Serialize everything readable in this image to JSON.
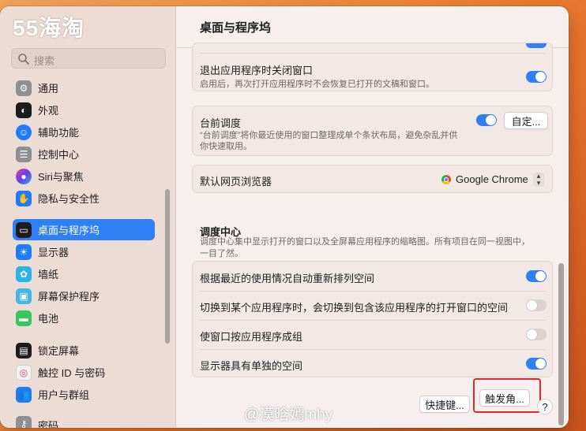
{
  "watermark": {
    "logo": "55海淘",
    "bottom_text": "@漠晗嫣mhy"
  },
  "sidebar": {
    "search_placeholder": "搜索",
    "items": [
      {
        "label": "通用",
        "icon": "gear-icon",
        "color": "#8e8e93",
        "selected": false
      },
      {
        "label": "外观",
        "icon": "appearance-icon",
        "color": "#1c1c1e",
        "selected": false
      },
      {
        "label": "辅助功能",
        "icon": "accessibility-icon",
        "color": "#1f7cf5",
        "selected": false
      },
      {
        "label": "控制中心",
        "icon": "control-center-icon",
        "color": "#8e8e93",
        "selected": false
      },
      {
        "label": "Siri与聚焦",
        "icon": "siri-icon",
        "color": "#6a3ee8",
        "selected": false
      },
      {
        "label": "隐私与安全性",
        "icon": "hand-icon",
        "color": "#1f7cf5",
        "selected": false
      },
      {
        "label": "桌面与程序坞",
        "icon": "dock-icon",
        "color": "#1c1c1e",
        "selected": true
      },
      {
        "label": "显示器",
        "icon": "display-icon",
        "color": "#1f7cf5",
        "selected": false
      },
      {
        "label": "墙纸",
        "icon": "wallpaper-icon",
        "color": "#2ab3e8",
        "selected": false
      },
      {
        "label": "屏幕保护程序",
        "icon": "screensaver-icon",
        "color": "#45b7e6",
        "selected": false
      },
      {
        "label": "电池",
        "icon": "battery-icon",
        "color": "#34c759",
        "selected": false
      },
      {
        "label": "锁定屏幕",
        "icon": "lock-screen-icon",
        "color": "#1c1c1e",
        "selected": false
      },
      {
        "label": "触控 ID 与密码",
        "icon": "fingerprint-icon",
        "color": "#f2f2f2",
        "selected": false
      },
      {
        "label": "用户与群组",
        "icon": "users-icon",
        "color": "#1f7cf5",
        "selected": false
      },
      {
        "label": "密码",
        "icon": "key-icon",
        "color": "#8e8e93",
        "selected": false
      }
    ]
  },
  "main": {
    "title": "桌面与程序坞",
    "close_windows": {
      "title": "退出应用程序时关闭窗口",
      "subtitle": "启用后，再次打开应用程序时不会恢复已打开的文稿和窗口。",
      "on": true
    },
    "stage_manager": {
      "title": "台前调度",
      "subtitle_line1": "“台前调度”将你最近使用的窗口整理成单个条状布局，避免杂乱并供",
      "subtitle_line2": "你快速取用。",
      "on": true,
      "customize_label": "自定..."
    },
    "default_browser": {
      "title": "默认网页浏览器",
      "value": "Google Chrome"
    },
    "mission_control": {
      "title": "调度中心",
      "description": "调度中心集中显示打开的窗口以及全屏幕应用程序的缩略图。所有项目在同一视图中，一目了然。",
      "rows": [
        {
          "label": "根据最近的使用情况自动重新排列空间",
          "on": true
        },
        {
          "label": "切换到某个应用程序时，会切换到包含该应用程序的打开窗口的空间",
          "on": false
        },
        {
          "label": "使窗口按应用程序成组",
          "on": false
        },
        {
          "label": "显示器具有单独的空间",
          "on": true
        }
      ]
    },
    "buttons": {
      "shortcuts": "快捷键...",
      "hot_corners": "触发角...",
      "help": "?"
    }
  },
  "colors": {
    "accent": "#2f7ff5",
    "highlight_box": "#e7262a"
  }
}
